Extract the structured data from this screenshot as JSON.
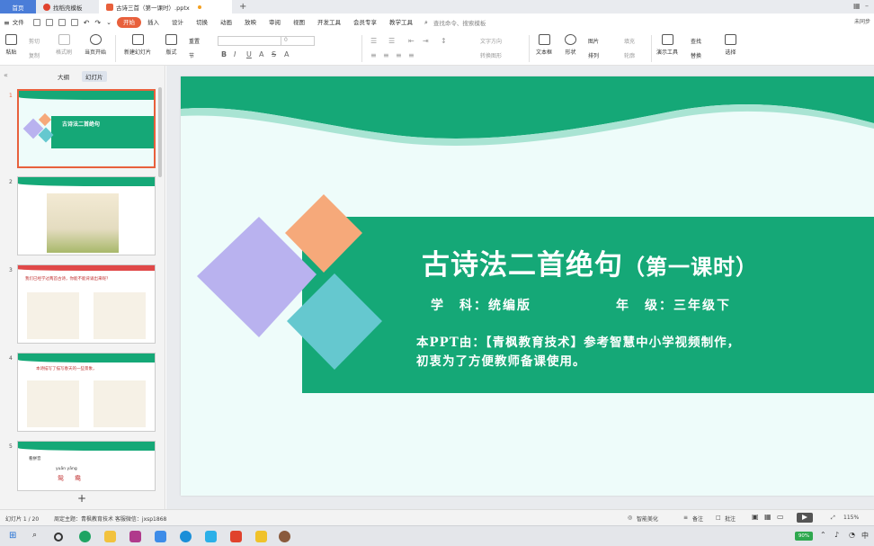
{
  "tabs": {
    "home": "首页",
    "template": "找稻壳模板",
    "file": "古诗三首（第一课时）.pptx"
  },
  "menu": {
    "file": "文件",
    "items": [
      "开始",
      "插入",
      "设计",
      "切换",
      "动画",
      "放映",
      "审阅",
      "视图",
      "开发工具",
      "会员专享",
      "教学工具"
    ],
    "active": "开始",
    "search": "查找命令、搜索模板",
    "share": "未同步"
  },
  "ribbon": {
    "paste": "粘贴",
    "cut": "剪切",
    "copy": "复制",
    "format_painter": "格式刷",
    "from_start": "当页开始",
    "new_slide": "新建幻灯片",
    "layout": "版式",
    "section": "节",
    "reset": "重置",
    "font_size": "0",
    "text_box": "文本框",
    "shape": "形状",
    "picture": "图片",
    "arrange": "排列",
    "fill": "填充",
    "outline": "轮廓",
    "present_tools": "演示工具",
    "find": "查找",
    "replace": "替换",
    "select": "选择",
    "convert_smartart": "转换图形",
    "text_direction": "文字方向",
    "align_text": "对齐文本"
  },
  "panel": {
    "outline": "大纲",
    "slides": "幻灯片",
    "slide_numbers": [
      "1",
      "2",
      "3",
      "4",
      "5"
    ]
  },
  "slide": {
    "title_main": "古诗法二首绝句",
    "title_paren": "（第一课时）",
    "subject": "学　科：统编版",
    "grade": "年　级：三年级下",
    "note_line1": "本PPT由：【青枫教育技术】参考智慧中小学视频制作，",
    "note_line2": "初衷为了方便教师备课使用。"
  },
  "thumbs": {
    "t3_text": "我们已经学过两首古诗，你能不能背诵出来呢？",
    "t4_text": "本诗描写了描写春天的一些景象，",
    "t5_title": "看拼音",
    "t5_pinyin": "yuān yāng",
    "t5_chars": "鸳鸯"
  },
  "status": {
    "slide_info": "幻灯片 1 / 20",
    "theme": "周定主题：青枫教育技术  客服微信：jxsp1868",
    "smart": "智能美化",
    "notes": "备注",
    "comment": "批注",
    "zoom": "115%"
  },
  "taskbar": {
    "battery": "90%"
  },
  "colors": {
    "accent": "#e8603c",
    "slide_green": "#15a877",
    "diamond_purple": "#b9b2ef",
    "diamond_orange": "#f6a97a",
    "diamond_teal": "#65c8cf"
  }
}
